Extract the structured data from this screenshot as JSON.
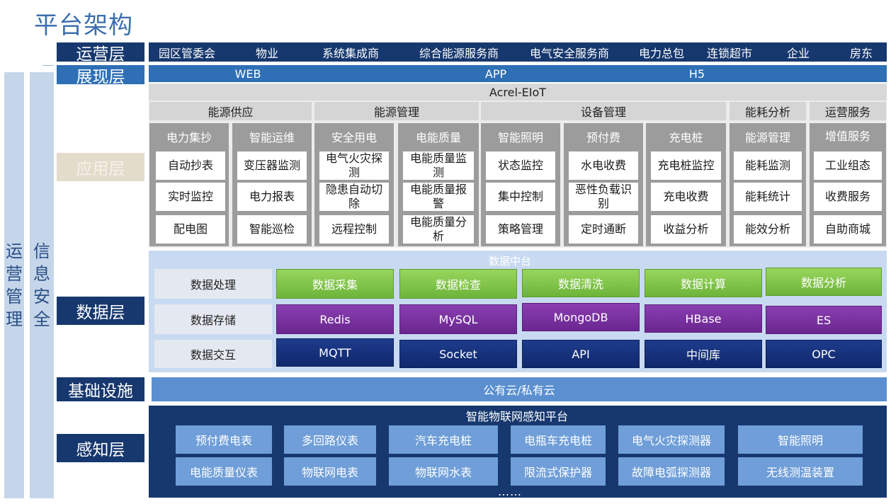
{
  "title": "平台架构",
  "side": {
    "ops_mgmt": "运营管理",
    "info_security": "信息安全"
  },
  "layers": {
    "ops": "运营层",
    "show": "展现层",
    "app": "应用层",
    "data": "数据层",
    "infra": "基础设施",
    "sense": "感知层"
  },
  "ops_items": [
    "园区管委会",
    "物业",
    "系统集成商",
    "综合能源服务商",
    "电气安全服务商",
    "电力总包",
    "连锁超市",
    "企业",
    "房东"
  ],
  "show_items": [
    "WEB",
    "APP",
    "H5"
  ],
  "app": {
    "platform": "Acrel-EIoT",
    "categories": [
      "能源供应",
      "能源管理",
      "设备管理",
      "能耗分析",
      "运营服务"
    ],
    "columns": [
      {
        "title": "电力集抄",
        "items": [
          "自动抄表",
          "实时监控",
          "配电图"
        ]
      },
      {
        "title": "智能运维",
        "items": [
          "变压器监测",
          "电力报表",
          "智能巡检"
        ]
      },
      {
        "title": "安全用电",
        "items": [
          "电气火灾探测",
          "隐患自动切除",
          "远程控制"
        ]
      },
      {
        "title": "电能质量",
        "items": [
          "电能质量监测",
          "电能质量报警",
          "电能质量分析"
        ]
      },
      {
        "title": "智能照明",
        "items": [
          "状态监控",
          "集中控制",
          "策略管理"
        ]
      },
      {
        "title": "预付费",
        "items": [
          "水电收费",
          "恶性负载识别",
          "定时通断"
        ]
      },
      {
        "title": "充电桩",
        "items": [
          "充电桩监控",
          "充电收费",
          "收益分析"
        ]
      },
      {
        "title": "能源管理",
        "items": [
          "能耗监测",
          "能耗统计",
          "能效分析"
        ]
      },
      {
        "title": "增值服务",
        "items": [
          "工业组态",
          "收费服务",
          "自助商城"
        ]
      }
    ]
  },
  "data": {
    "center": "数据中台",
    "rows": [
      {
        "label": "数据处理",
        "items": [
          "数据采集",
          "数据检查",
          "数据清洗",
          "数据计算",
          "数据分析"
        ]
      },
      {
        "label": "数据存储",
        "items": [
          "Redis",
          "MySQL",
          "MongoDB",
          "HBase",
          "ES"
        ]
      },
      {
        "label": "数据交互",
        "items": [
          "MQTT",
          "Socket",
          "API",
          "中间库",
          "OPC"
        ]
      }
    ]
  },
  "infra": {
    "label": "公有云/私有云"
  },
  "sense": {
    "title": "智能物联网感知平台",
    "row1": [
      "预付费电表",
      "多回路仪表",
      "汽车充电桩",
      "电瓶车充电桩",
      "电气火灾探测器",
      "智能照明"
    ],
    "row2": [
      "电能质量仪表",
      "物联网电表",
      "物联网水表",
      "限流式保护器",
      "故障电弧探测器",
      "无线测温装置"
    ],
    "more": "……"
  },
  "colors": {
    "navy": "#17386e",
    "blue": "#2e6fb5",
    "green": "#7ec04a",
    "purple": "#7a2fa0",
    "dark_blue": "#152f78",
    "light_blue": "#6f9ed8"
  }
}
